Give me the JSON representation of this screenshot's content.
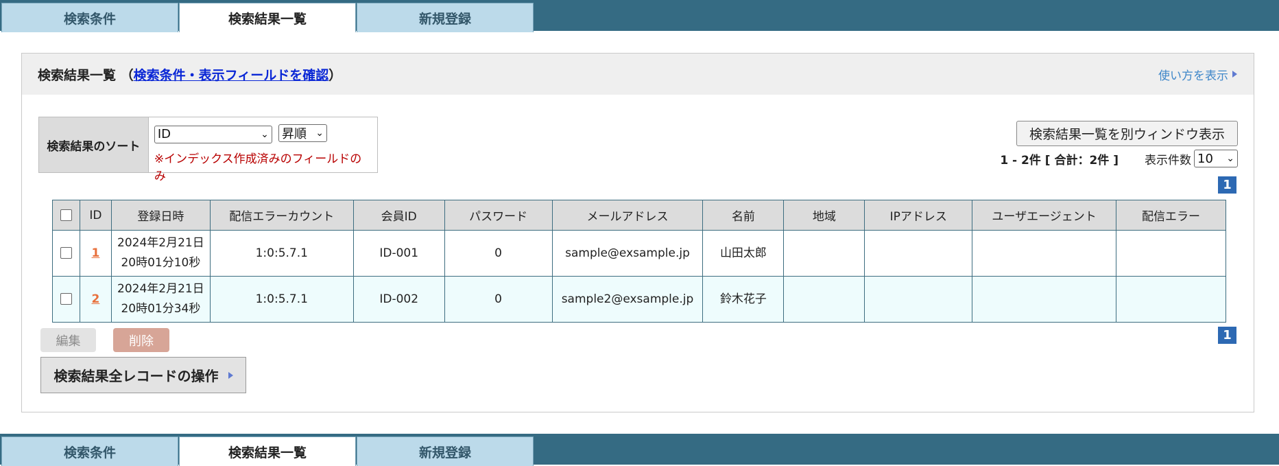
{
  "tabs": [
    {
      "label": "検索条件",
      "active": false
    },
    {
      "label": "検索結果一覧",
      "active": true
    },
    {
      "label": "新規登録",
      "active": false
    }
  ],
  "header": {
    "title": "検索結果一覧",
    "paren_open": "（",
    "link": "検索条件・表示フィールドを確認",
    "paren_close": "）",
    "howto": "使い方を表示"
  },
  "sort": {
    "label": "検索結果のソート",
    "field": "ID",
    "order": "昇順",
    "note": "※インデックス作成済みのフィールドのみ"
  },
  "results": {
    "open_window_label": "検索結果一覧を別ウィンドウ表示",
    "count_text": "1 - 2件 [ 合計：2件 ]",
    "per_page_label": "表示件数",
    "per_page_value": "10",
    "page": "1"
  },
  "table": {
    "columns": [
      "ID",
      "登録日時",
      "配信エラーカウント",
      "会員ID",
      "パスワード",
      "メールアドレス",
      "名前",
      "地域",
      "IPアドレス",
      "ユーザエージェント",
      "配信エラー"
    ],
    "rows": [
      {
        "id": "1",
        "date": "2024年2月21日",
        "time": "20時01分10秒",
        "error_count": "1:0:5.7.1",
        "member_id": "ID-001",
        "password": "0",
        "email": "sample@exsample.jp",
        "name": "山田太郎",
        "region": "",
        "ip": "",
        "ua": "",
        "error": ""
      },
      {
        "id": "2",
        "date": "2024年2月21日",
        "time": "20時01分34秒",
        "error_count": "1:0:5.7.1",
        "member_id": "ID-002",
        "password": "0",
        "email": "sample2@exsample.jp",
        "name": "鈴木花子",
        "region": "",
        "ip": "",
        "ua": "",
        "error": ""
      }
    ]
  },
  "actions": {
    "edit_label": "編集",
    "delete_label": "削除",
    "all_records_label": "検索結果全レコードの操作"
  },
  "colors": {
    "tabbar": "#356b83",
    "tab": "#bcdaea",
    "page_badge": "#2d69b3",
    "delete": "#d7a597"
  }
}
